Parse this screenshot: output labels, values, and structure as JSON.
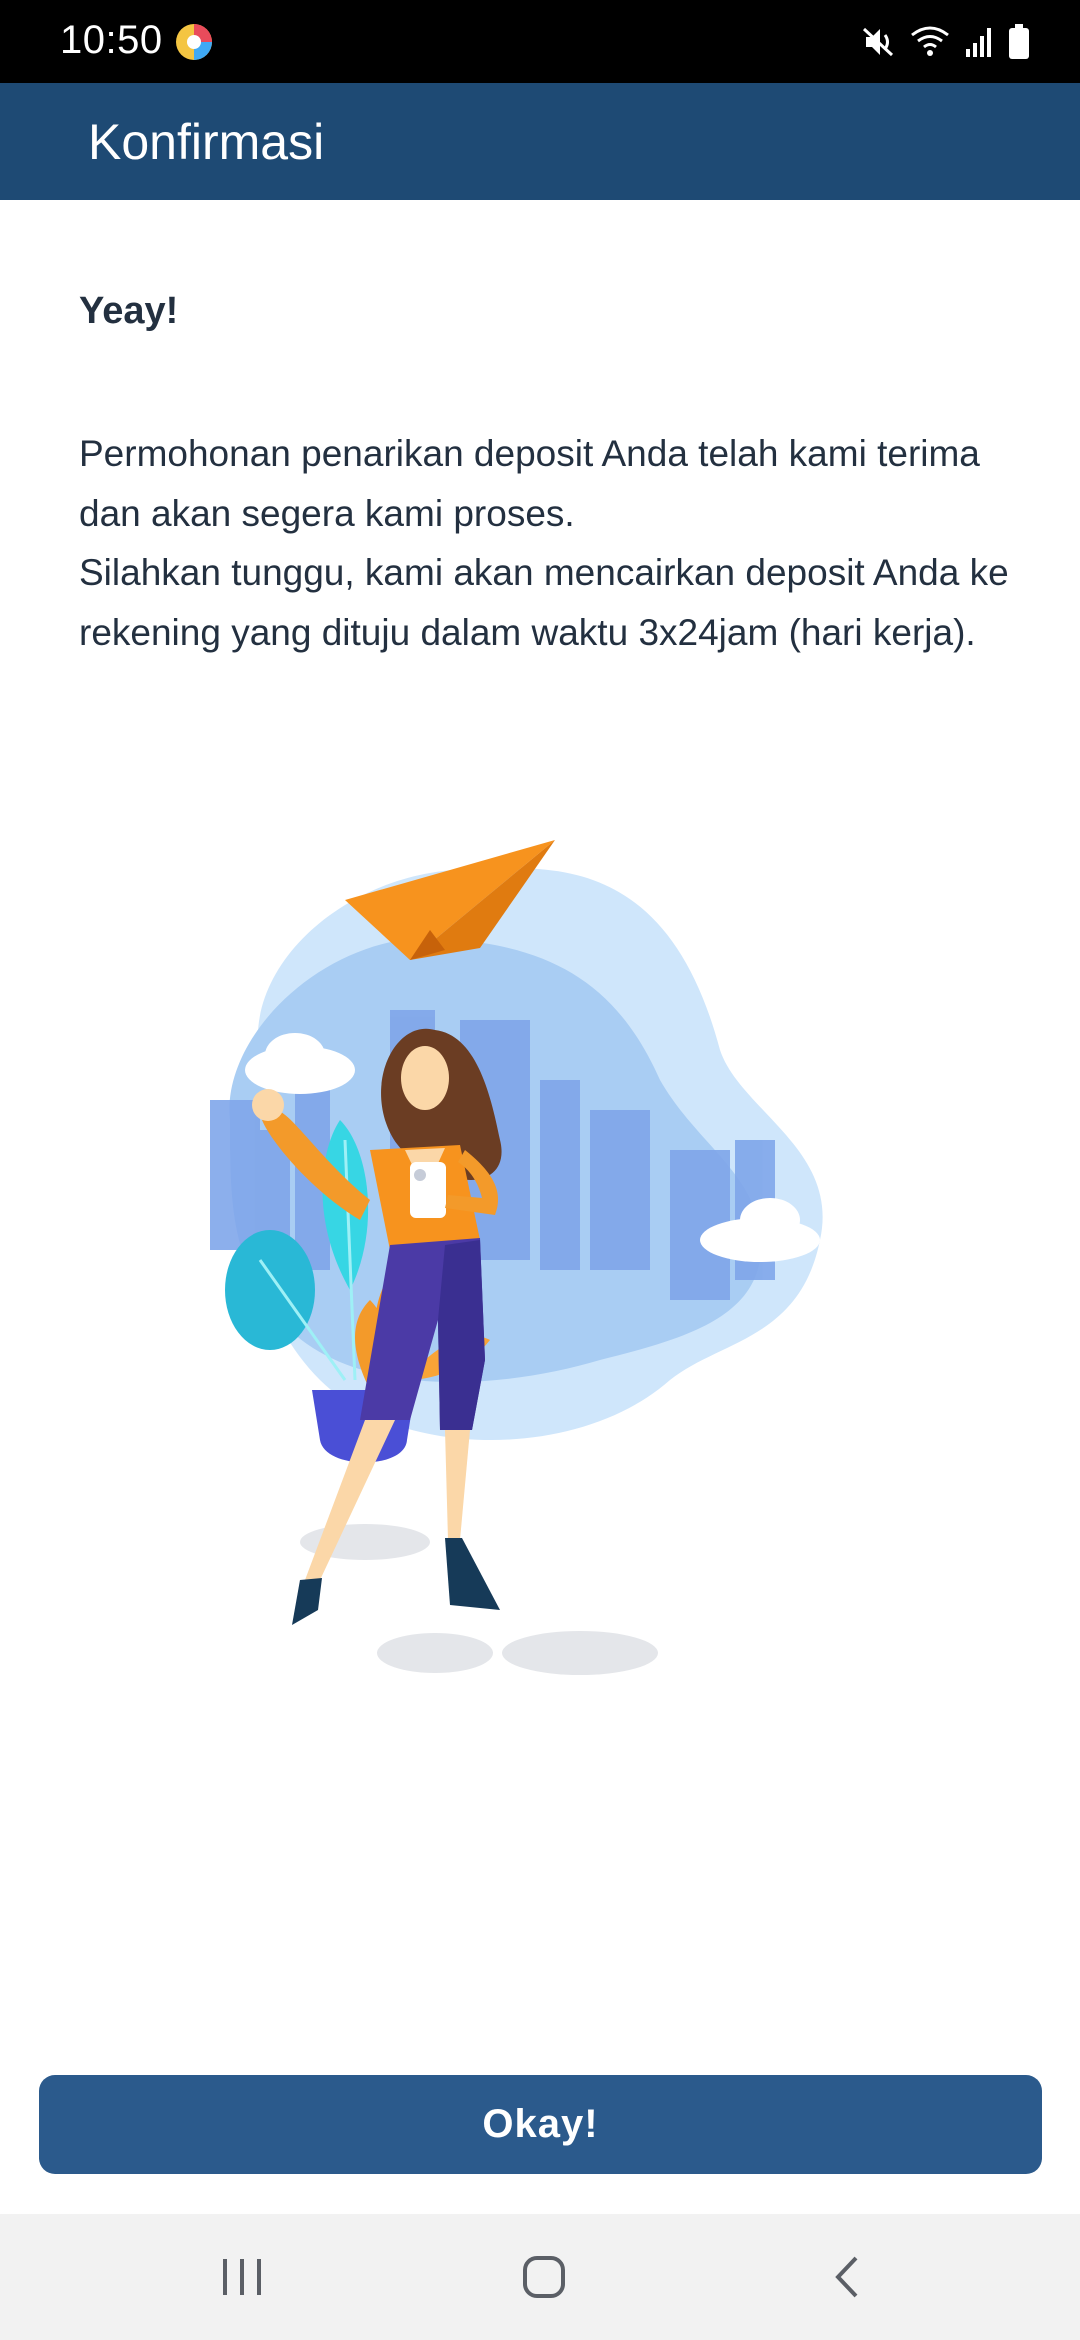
{
  "status_bar": {
    "time": "10:50",
    "icons": [
      "app-notification-icon",
      "mute-icon",
      "wifi-icon",
      "signal-icon",
      "battery-icon"
    ]
  },
  "app_bar": {
    "title": "Konfirmasi"
  },
  "content": {
    "heading": "Yeay!",
    "message_lines": [
      "Permohonan penarikan deposit Anda telah kami terima dan akan segera kami proses.",
      "Silahkan tunggu, kami akan mencairkan deposit Anda ke rekening yang dituju dalam waktu 3x24jam (hari kerja)."
    ]
  },
  "illustration": {
    "name": "woman-with-paper-plane-illustration"
  },
  "button": {
    "label": "Okay!"
  },
  "nav_bar": {
    "icons": [
      "recents-icon",
      "home-icon",
      "back-icon"
    ]
  },
  "colors": {
    "app_bar": "#1e4a74",
    "button": "#2b5a8c",
    "status_bar": "#000000",
    "nav_bar": "#f2f2f2"
  }
}
